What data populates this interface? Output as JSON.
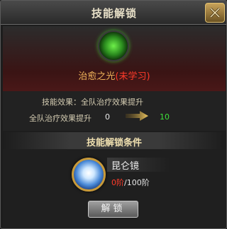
{
  "dialog": {
    "title": "技能解锁"
  },
  "skill": {
    "name": "治愈之光",
    "status": "(未学习)",
    "icon": "green-glow-skill-icon"
  },
  "effect": {
    "line": "技能效果：全队治疗效果提升",
    "boost_label": "全队治疗效果提升",
    "from": "0",
    "to": "10"
  },
  "conditions": {
    "title": "技能解锁条件",
    "item": {
      "name": "昆仑镜",
      "icon": "kunlun-mirror-icon",
      "current": "0阶",
      "required": "/100阶"
    }
  },
  "buttons": {
    "unlock": "解锁"
  },
  "colors": {
    "status_red": "#ff3b2a",
    "value_green": "#3ee03a",
    "skill_gold": "#f0b45a"
  }
}
